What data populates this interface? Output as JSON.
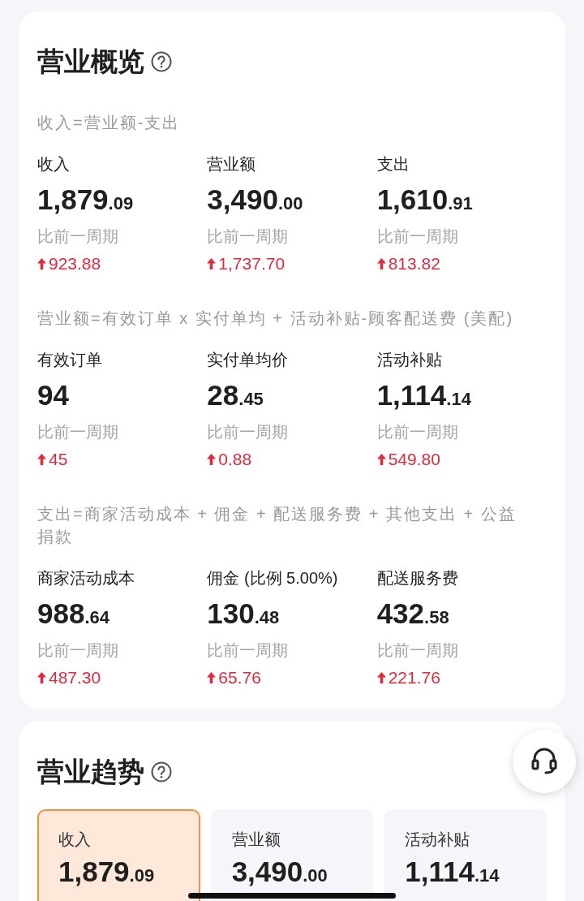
{
  "overview": {
    "title": "营业概览",
    "sections": [
      {
        "formula": "收入=营业额-支出",
        "metrics": [
          {
            "label": "收入",
            "integer": "1,879",
            "decimal": ".09",
            "compare_label": "比前一周期",
            "change": "923.88"
          },
          {
            "label": "营业额",
            "integer": "3,490",
            "decimal": ".00",
            "compare_label": "比前一周期",
            "change": "1,737.70"
          },
          {
            "label": "支出",
            "integer": "1,610",
            "decimal": ".91",
            "compare_label": "比前一周期",
            "change": "813.82"
          }
        ]
      },
      {
        "formula": "营业额=有效订单 x 实付单均 + 活动补贴-顾客配送费 (美配)",
        "metrics": [
          {
            "label": "有效订单",
            "integer": "94",
            "compare_label": "比前一周期",
            "change": "45"
          },
          {
            "label": "实付单均价",
            "integer": "28",
            "decimal": ".45",
            "compare_label": "比前一周期",
            "change": "0.88"
          },
          {
            "label": "活动补贴",
            "integer": "1,114",
            "decimal": ".14",
            "compare_label": "比前一周期",
            "change": "549.80"
          }
        ]
      },
      {
        "formula": "支出=商家活动成本 + 佣金 + 配送服务费 + 其他支出 + 公益捐款",
        "metrics": [
          {
            "label": "商家活动成本",
            "integer": "988",
            "decimal": ".64",
            "compare_label": "比前一周期",
            "change": "487.30"
          },
          {
            "label": "佣金 (比例 5.00%)",
            "integer": "130",
            "decimal": ".48",
            "compare_label": "比前一周期",
            "change": "65.76"
          },
          {
            "label": "配送服务费",
            "integer": "432",
            "decimal": ".58",
            "compare_label": "比前一周期",
            "change": "221.76"
          }
        ]
      }
    ]
  },
  "trend": {
    "title": "营业趋势",
    "tiles": [
      {
        "label": "收入",
        "integer": "1,879",
        "decimal": ".09",
        "selected": true
      },
      {
        "label": "营业额",
        "integer": "3,490",
        "decimal": ".00",
        "selected": false
      },
      {
        "label": "活动补贴",
        "integer": "1,114",
        "decimal": ".14",
        "selected": false
      }
    ]
  }
}
